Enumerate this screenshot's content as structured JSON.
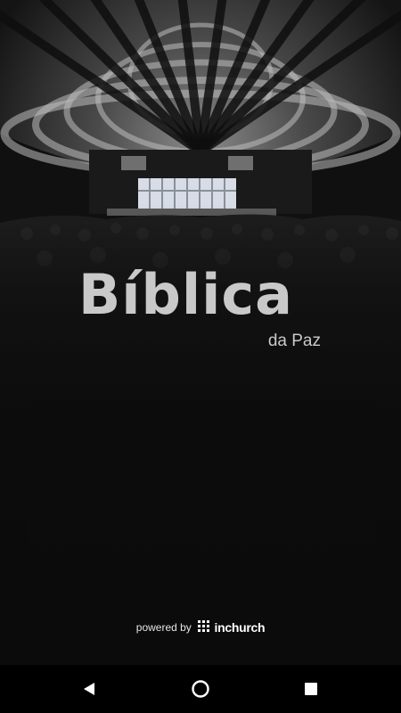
{
  "app": {
    "brand_name": "Bíblica",
    "brand_subtitle": "da Paz"
  },
  "footer": {
    "powered_by": "powered by",
    "provider": "inchurch"
  },
  "navigation_bar": {
    "buttons": [
      "back-icon",
      "home-icon",
      "recents-icon"
    ]
  },
  "colors": {
    "background": "#0b0b0b",
    "logo": "#c9c9c9",
    "footer_text": "#e6e6e6",
    "navbar": "#000000"
  }
}
